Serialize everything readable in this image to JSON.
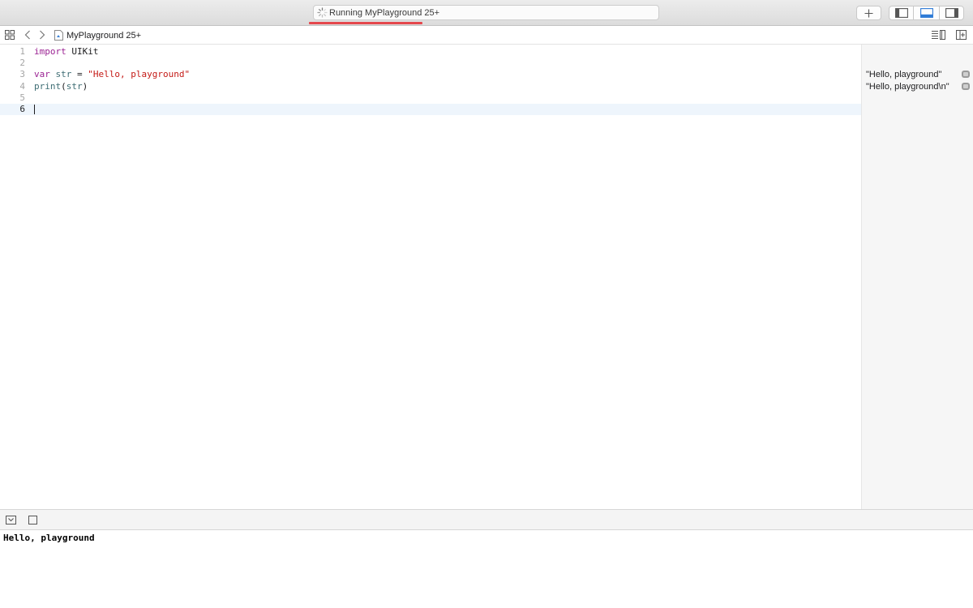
{
  "toolbar": {
    "activity_status": "Running MyPlayground 25+",
    "add_icon": "plus-icon",
    "view_toggles": [
      "navigator-toggle-icon",
      "debug-area-toggle-icon",
      "inspector-toggle-icon"
    ],
    "selected_view_toggle": "debug-area-toggle-icon"
  },
  "jumpbar": {
    "file_name": "MyPlayground 25+",
    "icons": [
      "grid-icon",
      "chevron-left-icon",
      "chevron-right-icon",
      "playground-file-icon",
      "editor-options-icon",
      "add-editor-icon"
    ]
  },
  "editor": {
    "lines": [
      {
        "number": "1",
        "tokens": [
          {
            "text": "import",
            "kind": "kw"
          },
          {
            "text": " UIKit",
            "kind": "plain"
          }
        ]
      },
      {
        "number": "2",
        "tokens": []
      },
      {
        "number": "3",
        "tokens": [
          {
            "text": "var",
            "kind": "kw"
          },
          {
            "text": " ",
            "kind": "plain"
          },
          {
            "text": "str",
            "kind": "ident"
          },
          {
            "text": " = ",
            "kind": "plain"
          },
          {
            "text": "\"Hello, playground\"",
            "kind": "str"
          }
        ]
      },
      {
        "number": "4",
        "tokens": [
          {
            "text": "print",
            "kind": "ident"
          },
          {
            "text": "(",
            "kind": "plain"
          },
          {
            "text": "str",
            "kind": "ident"
          },
          {
            "text": ")",
            "kind": "plain"
          }
        ]
      },
      {
        "number": "5",
        "tokens": []
      },
      {
        "number": "6",
        "tokens": [],
        "current": true
      }
    ]
  },
  "results": [
    {
      "line": "3",
      "text": "\"Hello, playground\"",
      "icon": "quick-look-icon"
    },
    {
      "line": "4",
      "text": "\"Hello, playground\\n\"",
      "icon": "quick-look-icon"
    }
  ],
  "debug": {
    "icons": [
      "hide-debug-area-icon",
      "console-toggle-icon"
    ],
    "console_output": "Hello, playground"
  },
  "colors": {
    "keyword": "#9b2393",
    "identifier": "#3e6d74",
    "string": "#c41a16",
    "progress": "#e5484d",
    "selected_toggle": "#2f7bd6"
  }
}
